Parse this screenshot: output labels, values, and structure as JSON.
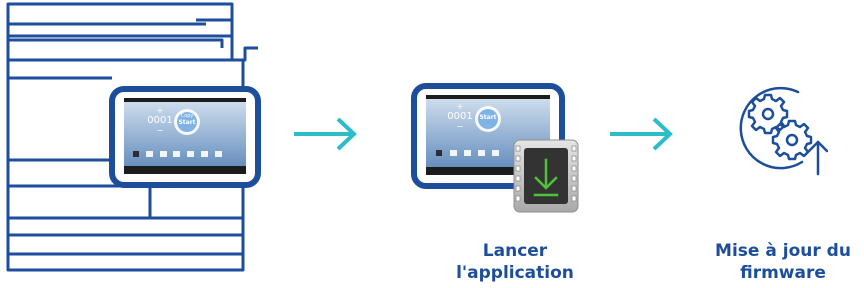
{
  "colors": {
    "outline_blue": "#1d4e9b",
    "arrow_teal": "#2bbec9",
    "screen_gradient_top": "#c7d7ea",
    "screen_gradient_bottom": "#5f8bbd",
    "module_grey": "#c8c8c8",
    "module_screen": "#333333",
    "download_green": "#4fc33a"
  },
  "device_screen": {
    "plus_label": "+",
    "counter": "0001",
    "minus_label": "−",
    "start_button_top": "Copy",
    "start_button": "Start"
  },
  "app_screen": {
    "plus_label": "+",
    "counter": "0001",
    "minus_label": "−",
    "start_button": "Start"
  },
  "steps": [
    {
      "icon": "download-module-icon",
      "label_line1": "Lancer",
      "label_line2": "l'application"
    },
    {
      "icon": "firmware-update-icon",
      "label_line1": "Mise à jour du",
      "label_line2": "firmware"
    }
  ]
}
